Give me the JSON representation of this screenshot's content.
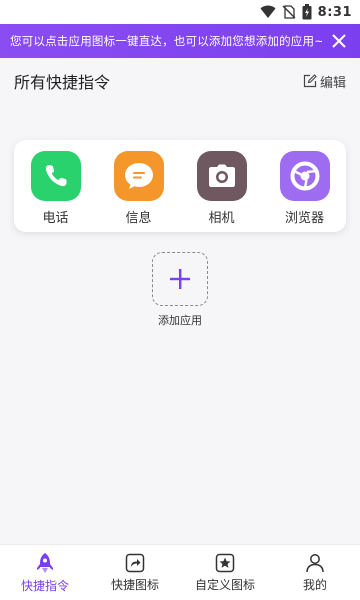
{
  "status": {
    "time": "8:31"
  },
  "banner": {
    "text": "您可以点击应用图标一键直达，也可以添加您想添加的应用~"
  },
  "header": {
    "title": "所有快捷指令",
    "edit_label": "编辑"
  },
  "apps": [
    {
      "label": "电话",
      "icon": "phone-icon",
      "color": "#2ad26e"
    },
    {
      "label": "信息",
      "icon": "message-icon",
      "color": "#f5962b"
    },
    {
      "label": "相机",
      "icon": "camera-icon",
      "color": "#6f5860"
    },
    {
      "label": "浏览器",
      "icon": "browser-icon",
      "color": "#9d6cf0"
    }
  ],
  "add": {
    "label": "添加应用"
  },
  "nav": [
    {
      "label": "快捷指令",
      "icon": "rocket-icon",
      "active": true
    },
    {
      "label": "快捷图标",
      "icon": "share-icon",
      "active": false
    },
    {
      "label": "自定义图标",
      "icon": "star-icon",
      "active": false
    },
    {
      "label": "我的",
      "icon": "profile-icon",
      "active": false
    }
  ],
  "colors": {
    "accent": "#7a3ff0",
    "banner": "#8a4df2"
  }
}
